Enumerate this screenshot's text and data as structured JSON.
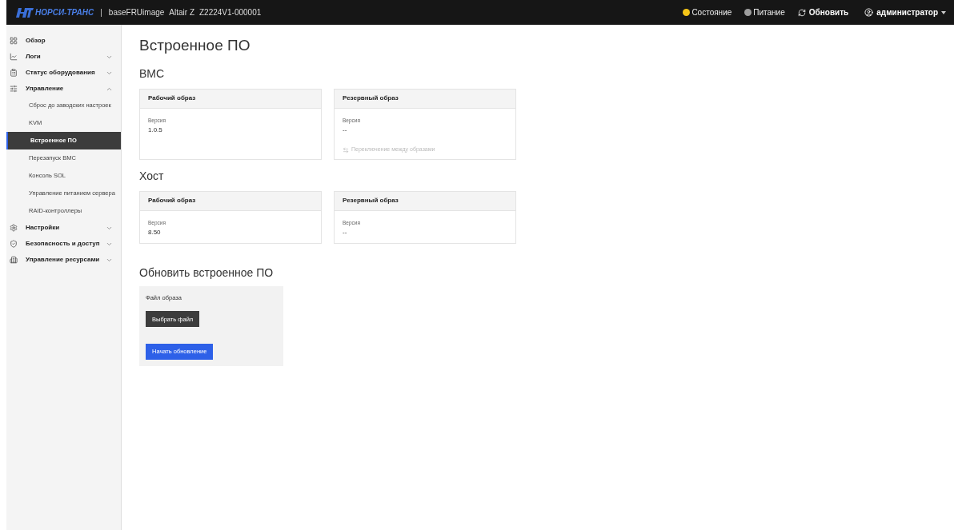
{
  "header": {
    "logo": "НОРСИ-ТРАНС",
    "separator": "|",
    "info": [
      "baseFRUimage",
      "Altair Z",
      "Z2224V1-000001"
    ],
    "status": [
      {
        "label": "Состояние",
        "color": "#f5c518"
      },
      {
        "label": "Питание",
        "color": "#9e9e9e"
      }
    ],
    "refresh": "Обновить",
    "user": "администратор"
  },
  "sidebar": {
    "items": [
      {
        "label": "Обзор"
      },
      {
        "label": "Логи",
        "expanded": false
      },
      {
        "label": "Статус оборудования",
        "expanded": false
      },
      {
        "label": "Управление",
        "expanded": true,
        "children": [
          {
            "label": "Сброс до заводских настроек",
            "selected": false
          },
          {
            "label": "KVM",
            "selected": false
          },
          {
            "label": "Встроенное ПО",
            "selected": true
          },
          {
            "label": "Перезапуск BMC",
            "selected": false
          },
          {
            "label": "Консоль SOL",
            "selected": false
          },
          {
            "label": "Управление питанием сервера",
            "selected": false
          },
          {
            "label": "RAID-контроллеры",
            "selected": false
          }
        ]
      },
      {
        "label": "Настройки",
        "expanded": false
      },
      {
        "label": "Безопасность и доступ",
        "expanded": false
      },
      {
        "label": "Управление ресурсами",
        "expanded": false
      }
    ]
  },
  "page_title": "Встроенное ПО",
  "sections": [
    {
      "title": "BMC",
      "cards": [
        {
          "title": "Рабочий образ",
          "label": "Версия",
          "value": "1.0.5"
        },
        {
          "title": "Резервный образ",
          "label": "Версия",
          "value": "--",
          "action": {
            "label": "Переключение между образами",
            "disabled": true
          }
        }
      ]
    },
    {
      "title": "Хост",
      "cards": [
        {
          "title": "Рабочий образ",
          "label": "Версия",
          "value": "8.50"
        },
        {
          "title": "Резервный образ",
          "label": "Версия",
          "value": "--"
        }
      ]
    }
  ],
  "update": {
    "title": "Обновить встроенное ПО",
    "file_label": "Файл образа",
    "choose_button": "Выбрать файл",
    "start_button": "Начать обновление"
  }
}
